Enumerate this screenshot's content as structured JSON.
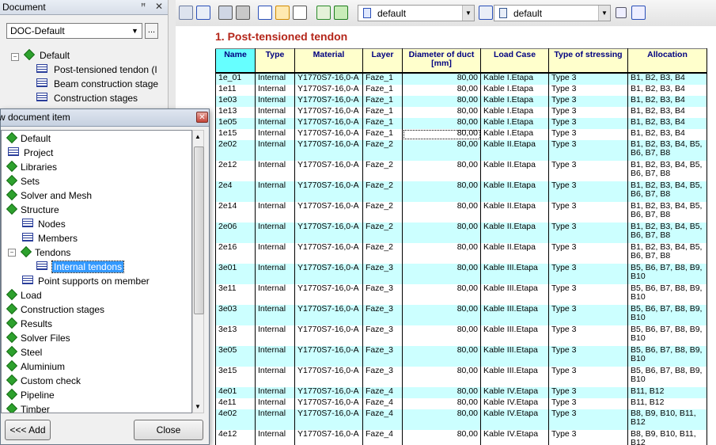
{
  "document_panel": {
    "title": "Document",
    "pin_glyph": "ꟸ",
    "close_glyph": "✕",
    "selector_value": "DOC-Default",
    "more_label": "...",
    "tree": [
      {
        "label": "Default",
        "icon": "diamond-icon"
      },
      {
        "label": "Post-tensioned tendon (I",
        "icon": "table-icon"
      },
      {
        "label": "Beam construction stage",
        "icon": "table-icon"
      },
      {
        "label": "Construction stages",
        "icon": "table-icon"
      }
    ]
  },
  "toolbar": {
    "combo1_value": "default",
    "combo2_value": "default"
  },
  "report": {
    "title": "1. Post-tensioned tendon",
    "columns": [
      "Name",
      "Type",
      "Material",
      "Layer",
      "Diameter of duct [mm]",
      "Load Case",
      "Type of stressing",
      "Allocation"
    ],
    "rows": [
      [
        "1e_01",
        "Internal",
        "Y1770S7-16,0-A",
        "Faze_1",
        "80,00",
        "Kable I.Etapa",
        "Type 3",
        "B1, B2, B3, B4"
      ],
      [
        "1e11",
        "Internal",
        "Y1770S7-16,0-A",
        "Faze_1",
        "80,00",
        "Kable I.Etapa",
        "Type 3",
        "B1, B2, B3, B4"
      ],
      [
        "1e03",
        "Internal",
        "Y1770S7-16,0-A",
        "Faze_1",
        "80,00",
        "Kable I.Etapa",
        "Type 3",
        "B1, B2, B3, B4"
      ],
      [
        "1e13",
        "Internal",
        "Y1770S7-16,0-A",
        "Faze_1",
        "80,00",
        "Kable I.Etapa",
        "Type 3",
        "B1, B2, B3, B4"
      ],
      [
        "1e05",
        "Internal",
        "Y1770S7-16,0-A",
        "Faze_1",
        "80,00",
        "Kable I.Etapa",
        "Type 3",
        "B1, B2, B3, B4"
      ],
      [
        "1e15",
        "Internal",
        "Y1770S7-16,0-A",
        "Faze_1",
        "80,00",
        "Kable I.Etapa",
        "Type 3",
        "B1, B2, B3, B4"
      ],
      [
        "2e02",
        "Internal",
        "Y1770S7-16,0-A",
        "Faze_2",
        "80,00",
        "Kable II.Etapa",
        "Type 3",
        "B1, B2, B3, B4, B5, B6, B7, B8"
      ],
      [
        "2e12",
        "Internal",
        "Y1770S7-16,0-A",
        "Faze_2",
        "80,00",
        "Kable II.Etapa",
        "Type 3",
        "B1, B2, B3, B4, B5, B6, B7, B8"
      ],
      [
        "2e4",
        "Internal",
        "Y1770S7-16,0-A",
        "Faze_2",
        "80,00",
        "Kable II.Etapa",
        "Type 3",
        "B1, B2, B3, B4, B5, B6, B7, B8"
      ],
      [
        "2e14",
        "Internal",
        "Y1770S7-16,0-A",
        "Faze_2",
        "80,00",
        "Kable II.Etapa",
        "Type 3",
        "B1, B2, B3, B4, B5, B6, B7, B8"
      ],
      [
        "2e06",
        "Internal",
        "Y1770S7-16,0-A",
        "Faze_2",
        "80,00",
        "Kable II.Etapa",
        "Type 3",
        "B1, B2, B3, B4, B5, B6, B7, B8"
      ],
      [
        "2e16",
        "Internal",
        "Y1770S7-16,0-A",
        "Faze_2",
        "80,00",
        "Kable II.Etapa",
        "Type 3",
        "B1, B2, B3, B4, B5, B6, B7, B8"
      ],
      [
        "3e01",
        "Internal",
        "Y1770S7-16,0-A",
        "Faze_3",
        "80,00",
        "Kable III.Etapa",
        "Type 3",
        "B5, B6, B7, B8, B9, B10"
      ],
      [
        "3e11",
        "Internal",
        "Y1770S7-16,0-A",
        "Faze_3",
        "80,00",
        "Kable III.Etapa",
        "Type 3",
        "B5, B6, B7, B8, B9, B10"
      ],
      [
        "3e03",
        "Internal",
        "Y1770S7-16,0-A",
        "Faze_3",
        "80,00",
        "Kable III.Etapa",
        "Type 3",
        "B5, B6, B7, B8, B9, B10"
      ],
      [
        "3e13",
        "Internal",
        "Y1770S7-16,0-A",
        "Faze_3",
        "80,00",
        "Kable III.Etapa",
        "Type 3",
        "B5, B6, B7, B8, B9, B10"
      ],
      [
        "3e05",
        "Internal",
        "Y1770S7-16,0-A",
        "Faze_3",
        "80,00",
        "Kable III.Etapa",
        "Type 3",
        "B5, B6, B7, B8, B9, B10"
      ],
      [
        "3e15",
        "Internal",
        "Y1770S7-16,0-A",
        "Faze_3",
        "80,00",
        "Kable III.Etapa",
        "Type 3",
        "B5, B6, B7, B8, B9, B10"
      ],
      [
        "4e01",
        "Internal",
        "Y1770S7-16,0-A",
        "Faze_4",
        "80,00",
        "Kable IV.Etapa",
        "Type 3",
        "B11, B12"
      ],
      [
        "4e11",
        "Internal",
        "Y1770S7-16,0-A",
        "Faze_4",
        "80,00",
        "Kable IV.Etapa",
        "Type 3",
        "B11, B12"
      ],
      [
        "4e02",
        "Internal",
        "Y1770S7-16,0-A",
        "Faze_4",
        "80,00",
        "Kable IV.Etapa",
        "Type 3",
        "B8, B9, B10, B11, B12"
      ],
      [
        "4e12",
        "Internal",
        "Y1770S7-16,0-A",
        "Faze_4",
        "80,00",
        "Kable IV.Etapa",
        "Type 3",
        "B8, B9, B10, B11, B12"
      ]
    ]
  },
  "dialog": {
    "title": "w document item",
    "close_glyph": "✕",
    "tree": [
      {
        "label": "Default",
        "icon": "diamond-icon",
        "level": 0
      },
      {
        "label": "Project",
        "icon": "table-icon",
        "level": 0
      },
      {
        "label": "Libraries",
        "icon": "diamond-icon",
        "level": 0
      },
      {
        "label": "Sets",
        "icon": "diamond-icon",
        "level": 0
      },
      {
        "label": "Solver and Mesh",
        "icon": "diamond-icon",
        "level": 0
      },
      {
        "label": "Structure",
        "icon": "diamond-icon",
        "level": 0
      },
      {
        "label": "Nodes",
        "icon": "table-icon",
        "level": 1
      },
      {
        "label": "Members",
        "icon": "table-icon",
        "level": 1
      },
      {
        "label": "Tendons",
        "icon": "diamond-icon",
        "level": 1,
        "expander": "−"
      },
      {
        "label": "Internal tendons",
        "icon": "table-icon",
        "level": 2,
        "selected": true
      },
      {
        "label": "Point supports on member",
        "icon": "table-icon",
        "level": 1
      },
      {
        "label": "Load",
        "icon": "diamond-icon",
        "level": 0
      },
      {
        "label": "Construction stages",
        "icon": "diamond-icon",
        "level": 0
      },
      {
        "label": "Results",
        "icon": "diamond-icon",
        "level": 0
      },
      {
        "label": "Solver Files",
        "icon": "diamond-icon",
        "level": 0
      },
      {
        "label": "Steel",
        "icon": "diamond-icon",
        "level": 0
      },
      {
        "label": "Aluminium",
        "icon": "diamond-icon",
        "level": 0
      },
      {
        "label": "Custom check",
        "icon": "diamond-icon",
        "level": 0
      },
      {
        "label": "Pipeline",
        "icon": "diamond-icon",
        "level": 0
      },
      {
        "label": "Timber",
        "icon": "diamond-icon",
        "level": 0
      }
    ],
    "add_button": "<<< Add",
    "close_button": "Close"
  },
  "colors": {
    "title_red": "#b4261a",
    "header_bg": "#ffffcc",
    "name_header_bg": "#66ffff",
    "row_alt": "#ccffff",
    "header_text": "#000080"
  }
}
